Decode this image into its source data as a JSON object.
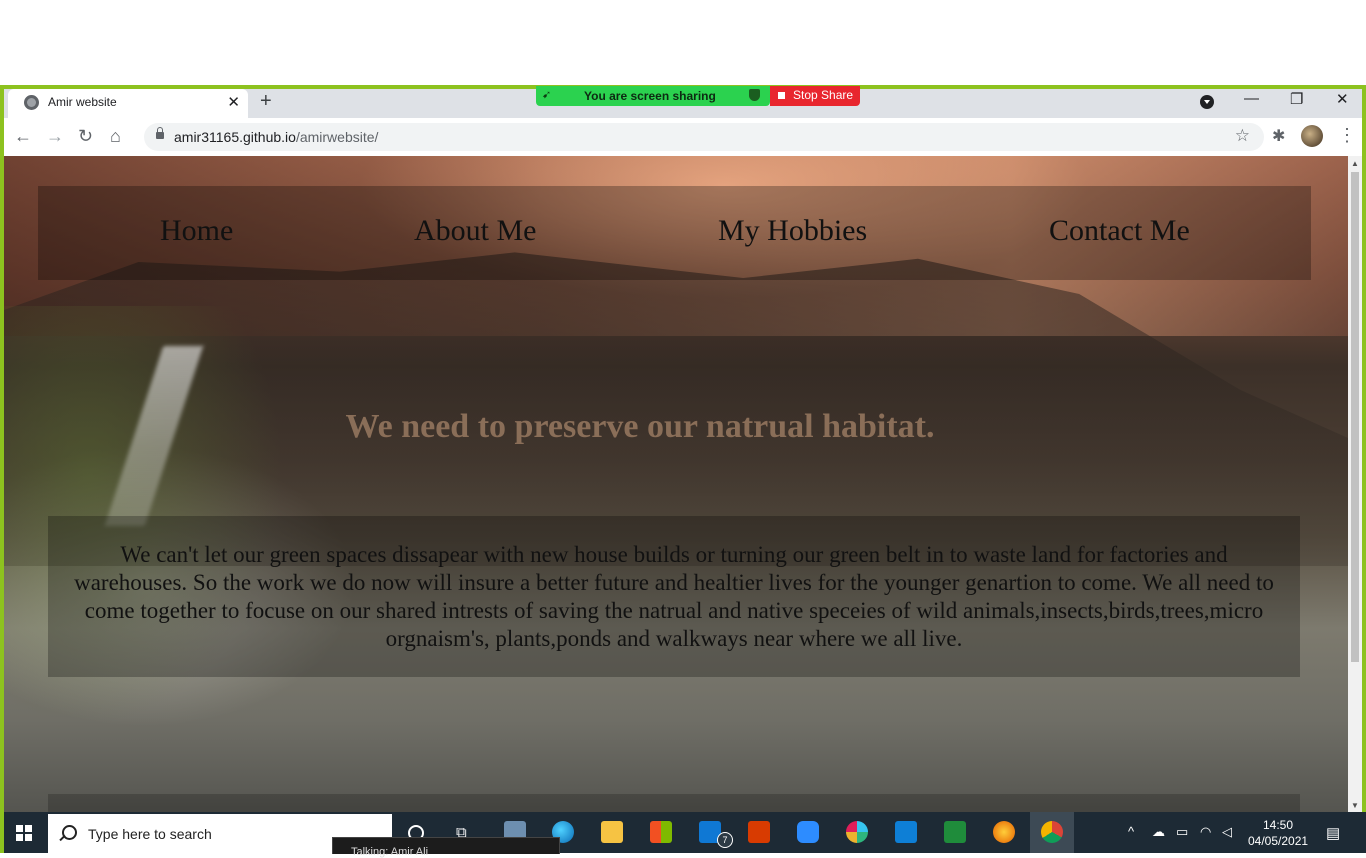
{
  "browser": {
    "tab_title": "Amir website",
    "tab_close": "✕",
    "new_tab": "+",
    "url_host": "amir31165.github.io",
    "url_path": "/amirwebsite/",
    "back": "←",
    "forward": "→",
    "reload": "↻",
    "home": "⌂",
    "star": "☆",
    "extensions": "✱",
    "menu": "⋮",
    "minimize": "—",
    "restore": "❐",
    "close": "✕"
  },
  "screen_share": {
    "status": "You are screen sharing",
    "stop_label": "Stop Share",
    "status_color": "#2bd24f",
    "stop_color": "#e8262e",
    "frame_color": "#8dc21f"
  },
  "website": {
    "nav": [
      "Home",
      "About Me",
      "My Hobbies",
      "Contact Me"
    ],
    "heading": "We need to preserve our natrual habitat.",
    "body_text": "We can't let our green spaces dissapear with new house builds or turning our green belt in to waste land for factories and warehouses. So the work we do now will insure a better future and healtier lives for the younger genartion to come. We all need to come together to focuse on our shared intrests of saving the natrual and native speceies of wild animals,insects,birds,trees,micro orgnaism's, plants,ponds and walkways near where we all live."
  },
  "taskbar": {
    "search_placeholder": "Type here to search",
    "mail_badge": "7",
    "time": "14:50",
    "date": "04/05/2021",
    "preview_text": "Talking: Amir Ali",
    "apps": [
      "cortana-icon",
      "task-view-icon",
      "people-icon",
      "edge-icon",
      "file-explorer-icon",
      "store-icon",
      "mail-icon",
      "office-icon",
      "zoom-icon",
      "slack-icon",
      "vscode-icon",
      "sheets-icon",
      "firefox-icon",
      "chrome-icon"
    ]
  }
}
